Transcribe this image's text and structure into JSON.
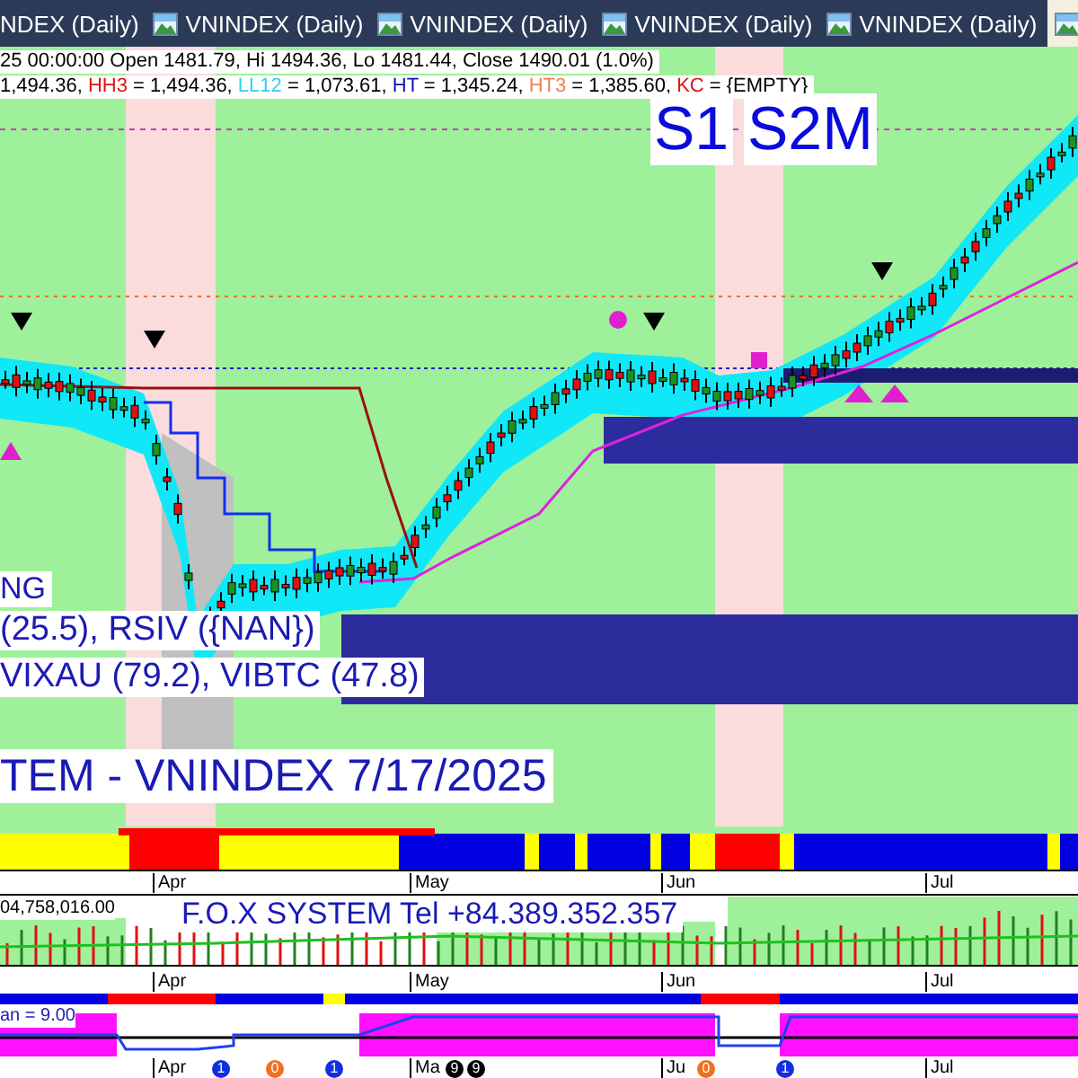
{
  "tabs": [
    {
      "label": "NDEX (Daily)",
      "icon": false,
      "selected": false
    },
    {
      "label": "VNINDEX (Daily)",
      "icon": true,
      "selected": false
    },
    {
      "label": "VNINDEX (Daily)",
      "icon": true,
      "selected": false
    },
    {
      "label": "VNINDEX (Daily)",
      "icon": true,
      "selected": false
    },
    {
      "label": "VNINDEX (Daily)",
      "icon": true,
      "selected": false
    },
    {
      "icon": true,
      "selected": true
    }
  ],
  "price_pane": {
    "quote_line": "25 00:00:00 Open 1481.79, Hi 1494.36, Lo 1481.44, Close 1490.01 (1.0%)",
    "values_line": [
      {
        "text": "1,494.36, ",
        "color": "#000000"
      },
      {
        "text": "HH3",
        "color": "#e01010"
      },
      {
        "text": " = 1,494.36, ",
        "color": "#000000"
      },
      {
        "text": "LL12",
        "color": "#30d0f0"
      },
      {
        "text": " = 1,073.61, ",
        "color": "#000000"
      },
      {
        "text": "HT",
        "color": "#1010c0"
      },
      {
        "text": "  = 1,345.24, ",
        "color": "#000000"
      },
      {
        "text": "HT3",
        "color": "#f08050"
      },
      {
        "text": "  = 1,385.60, ",
        "color": "#000000"
      },
      {
        "text": "KC",
        "color": "#e01010"
      },
      {
        "text": " = {EMPTY}",
        "color": "#000000"
      }
    ],
    "signals": [
      "S1",
      "S2M"
    ],
    "indicator_lines": [
      "NG",
      "(25.5), RSIV ({NAN})",
      "VIXAU (79.2), VIBTC (47.8)"
    ],
    "title": "TEM - VNINDEX 7/17/2025",
    "months": [
      "Apr",
      "May",
      "Jun",
      "Jul"
    ]
  },
  "volume_pane": {
    "reading": "04,758,016.00",
    "banner": "F.O.X SYSTEM Tel +84.389.352.357",
    "months": [
      "Apr",
      "May",
      "Jun",
      "Jul"
    ]
  },
  "oscillator_pane": {
    "reading": "an = 9.00",
    "months": [
      "Apr",
      "Ma",
      "Ju",
      "Jul"
    ],
    "badges": [
      {
        "text": "1",
        "color": "#1030e0"
      },
      {
        "text": "0",
        "color": "#f07020"
      },
      {
        "text": "1",
        "color": "#1030e0"
      },
      {
        "text": "9",
        "color": "#000000"
      },
      {
        "text": "9",
        "color": "#000000"
      },
      {
        "text": "0",
        "color": "#f07020"
      },
      {
        "text": "1",
        "color": "#1030e0"
      }
    ]
  }
}
